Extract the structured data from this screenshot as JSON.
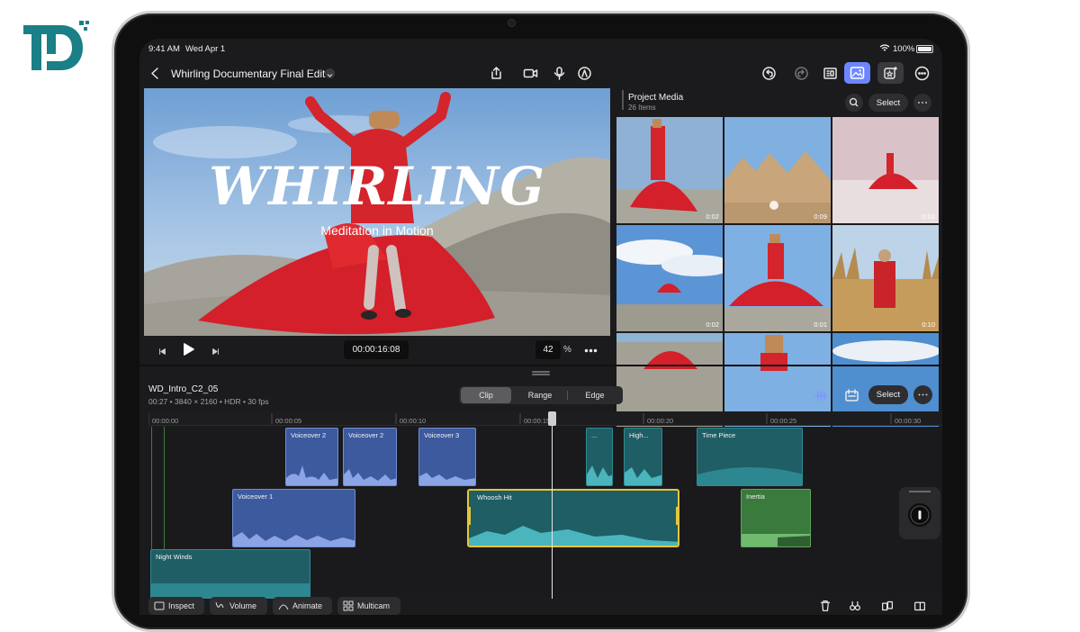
{
  "watermark": {
    "logo_text": "TD"
  },
  "status_bar": {
    "time": "9:41 AM",
    "date": "Wed Apr 1",
    "battery": "100%"
  },
  "toolbar": {
    "project_title": "Whirling Documentary Final Edit",
    "icons": [
      "back-icon",
      "dropdown-chevron-icon",
      "export-icon",
      "camera-icon",
      "microphone-icon",
      "pen-icon",
      "undo-icon",
      "redo-icon",
      "inspector-icon",
      "media-browser-icon",
      "effects-icon",
      "more-icon"
    ]
  },
  "viewer": {
    "title_overlay": "WHIRLING",
    "subtitle_overlay": "Meditation in Motion",
    "timecode": "00:00:16:08",
    "zoom": "42",
    "zoom_unit": "%"
  },
  "project_media": {
    "title": "Project Media",
    "count": "26 Items",
    "select_label": "Select",
    "thumbnails": [
      {
        "duration": "0:02"
      },
      {
        "duration": "0:09"
      },
      {
        "duration": "0:02"
      },
      {
        "duration": "0:02"
      },
      {
        "duration": "0:01"
      },
      {
        "duration": "0:10"
      },
      {
        "duration": ""
      },
      {
        "duration": ""
      },
      {
        "duration": ""
      }
    ]
  },
  "clip_info": {
    "name": "WD_Intro_C2_05",
    "details": "00:27 • 3840 × 2160 • HDR • 30 fps"
  },
  "segments": {
    "clip": "Clip",
    "range": "Range",
    "edge": "Edge",
    "active": "Clip"
  },
  "timeline": {
    "select_label": "Select",
    "ruler": [
      "00:00:00",
      "00:00:05",
      "00:00:10",
      "00:00:15",
      "00:00:20",
      "00:00:25",
      "00:00:30"
    ],
    "clips": {
      "vo2a": "Voiceover 2",
      "vo2b": "Voiceover 2",
      "vo3": "Voiceover 3",
      "short": "...",
      "high": "High...",
      "time_piece": "Time Piece",
      "vo1": "Voiceover 1",
      "whoosh": "Whoosh Hit",
      "inertia": "Inertia",
      "night": "Night Winds"
    }
  },
  "bottom_toolbar": {
    "inspect": "Inspect",
    "volume": "Volume",
    "animate": "Animate",
    "multicam": "Multicam"
  },
  "colors": {
    "voiceover_blue": "#3d5a9e",
    "music_teal": "#1f5e65",
    "inertia_green": "#3a7a3c",
    "selection_yellow": "#e2c63a",
    "accent_blue": "#6d86ff"
  }
}
